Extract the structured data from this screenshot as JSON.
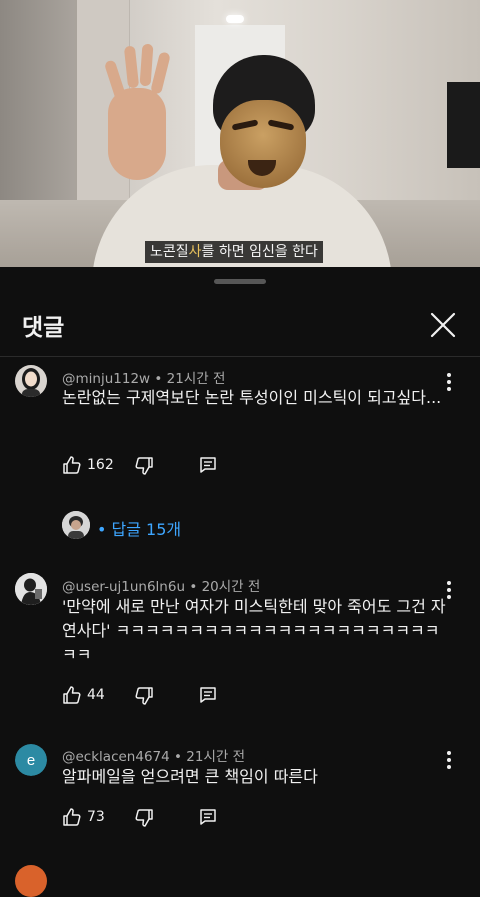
{
  "video": {
    "caption_pre": "노콘질",
    "caption_highlight": "사",
    "caption_post": "를 하면 임신을 한다"
  },
  "panel": {
    "title": "댓글"
  },
  "comments": [
    {
      "author": "@minju112w",
      "time": "21시간 전",
      "text": "논란없는 구제역보단 논란 투성이인 미스틱이 되고싶다...",
      "likes": "162",
      "replies_label": "• 답글 15개"
    },
    {
      "author": "@user-uj1un6ln6u",
      "time": "20시간 전",
      "text": "'만약에 새로 만난 여자가 미스틱한테 맞아 죽어도 그건 자연사다' ㅋㅋㅋㅋㅋㅋㅋㅋㅋㅋㅋㅋㅋㅋㅋㅋㅋㅋㅋㅋㅋㅋㅋㅋ",
      "likes": "44"
    },
    {
      "author": "@ecklacen4674",
      "time": "21시간 전",
      "text": "알파메일을 얻으려면 큰 책임이 따른다",
      "likes": "73",
      "avatar_letter": "e",
      "avatar_color": "#2c8aa3"
    }
  ],
  "separator": "•"
}
